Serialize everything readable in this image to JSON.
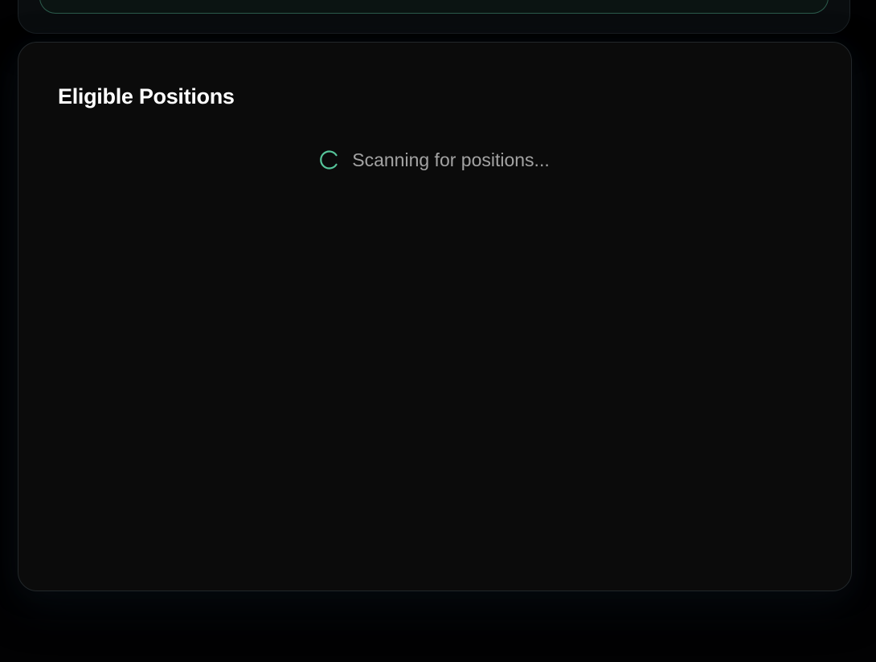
{
  "positions_panel": {
    "title": "Eligible Positions",
    "loading_text": "Scanning for positions...",
    "spinner_icon": "loading-spinner-icon"
  },
  "colors": {
    "accent": "#4ade80",
    "background": "#0b0b0b",
    "title_text": "#ffffff",
    "muted_text": "#a3a3a3"
  }
}
